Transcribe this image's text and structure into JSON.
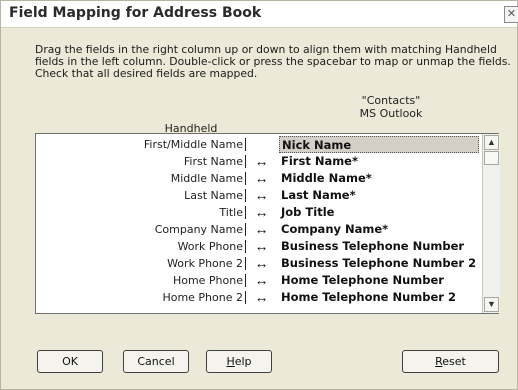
{
  "window": {
    "title": "Field Mapping for Address Book",
    "close_glyph": "✕"
  },
  "instructions": [
    "Drag the fields in the right column up or down to align them with matching Handheld",
    "fields in the left column.  Double-click or press the spacebar to map or unmap the fields.",
    "Check that all desired fields are mapped."
  ],
  "columns": {
    "handheld": "Handheld",
    "outlook_line1": "\"Contacts\"",
    "outlook_line2": "MS Outlook"
  },
  "mapping": {
    "left": [
      "First/Middle Name",
      "First Name",
      "Middle Name",
      "Last Name",
      "Title",
      "Company Name",
      "Work Phone",
      "Work Phone 2",
      "Home Phone",
      "Home Phone 2"
    ],
    "arrows": [
      "",
      "↔",
      "↔",
      "↔",
      "↔",
      "↔",
      "↔",
      "↔",
      "↔",
      "↔"
    ],
    "right": [
      "Nick Name",
      "First Name*",
      "Middle Name*",
      "Last Name*",
      "Job Title",
      "Company Name*",
      "Business Telephone Number",
      "Business Telephone Number 2",
      "Home Telephone Number",
      "Home Telephone Number 2"
    ]
  },
  "scrollbar": {
    "up": "▲",
    "down": "▼"
  },
  "buttons": {
    "ok": "OK",
    "cancel": "Cancel",
    "help_first": "H",
    "help_rest": "elp",
    "reset_first": "R",
    "reset_rest": "eset"
  }
}
